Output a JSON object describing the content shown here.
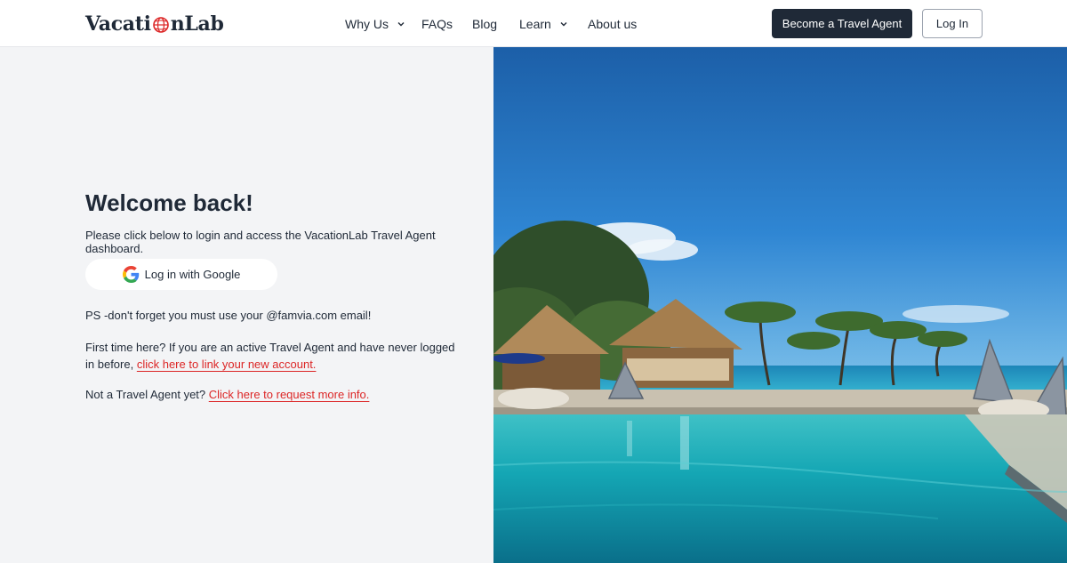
{
  "brand": {
    "name_part1": "Vacati",
    "name_part2": "nLab"
  },
  "nav": {
    "why_us": "Why Us",
    "faqs": "FAQs",
    "blog": "Blog",
    "learn": "Learn",
    "about": "About us"
  },
  "header": {
    "become_agent": "Become a Travel Agent",
    "login": "Log In"
  },
  "main": {
    "title": "Welcome back!",
    "intro": "Please click below to login and access the VacationLab Travel Agent dashboard.",
    "google_button": "Log in with Google",
    "ps": "PS -don't forget you must use your @famvia.com email!",
    "first_time": "First time here? If you are an active Travel Agent and have never logged in before, ",
    "first_time_link": "click here to link your new account.",
    "not_agent": "Not a Travel Agent yet? ",
    "not_agent_link": "Click here to request more info."
  },
  "colors": {
    "accent_dark": "#1f2937",
    "link_red": "#dc2626",
    "panel_bg": "#f3f4f6"
  },
  "icons": {
    "google": "google-icon",
    "chevron": "chevron-down-icon",
    "logo_globe": "globe-icon"
  }
}
